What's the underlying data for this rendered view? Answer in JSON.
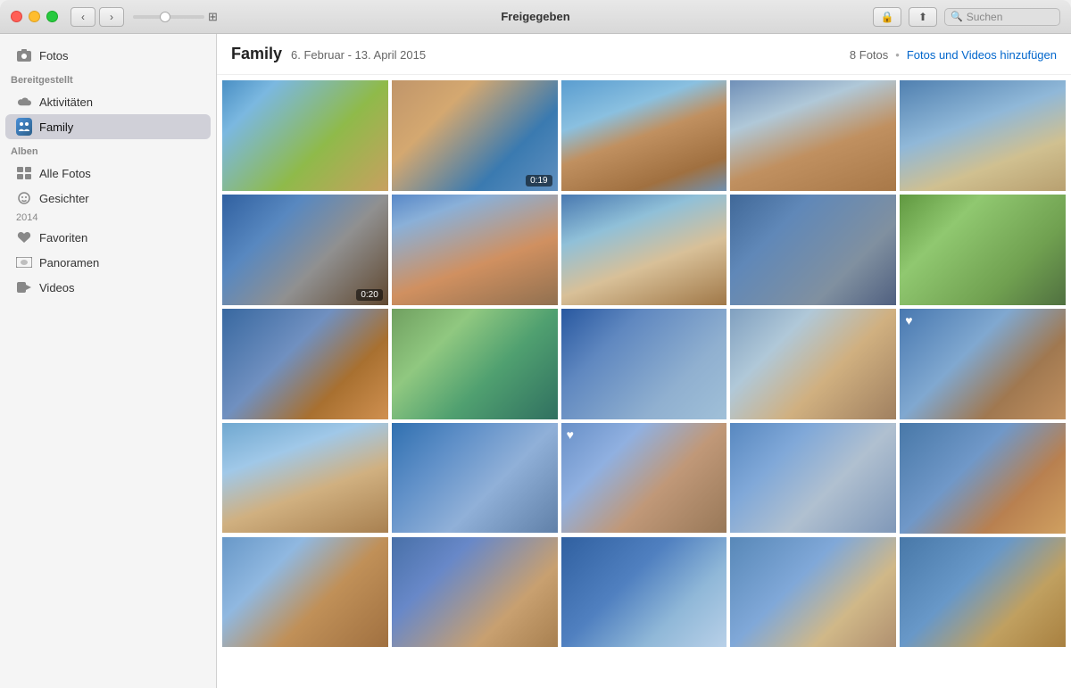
{
  "titleBar": {
    "title": "Freigegeben",
    "searchPlaceholder": "Suchen"
  },
  "sidebar": {
    "topItems": [
      {
        "id": "fotos",
        "label": "Fotos",
        "icon": "📷",
        "iconType": "camera"
      }
    ],
    "sections": [
      {
        "label": "Bereitgestellt",
        "items": [
          {
            "id": "aktivitaeten",
            "label": "Aktivitäten",
            "icon": "☁️",
            "iconType": "cloud"
          },
          {
            "id": "family",
            "label": "Family",
            "icon": "family",
            "iconType": "family",
            "active": true
          }
        ]
      },
      {
        "label": "Alben",
        "items": [
          {
            "id": "alle-fotos",
            "label": "Alle Fotos",
            "icon": "📋",
            "iconType": "list"
          },
          {
            "id": "gesichter",
            "label": "Gesichter",
            "icon": "👤",
            "iconType": "face",
            "badge": ""
          },
          {
            "id": "favoriten",
            "label": "Favoriten",
            "icon": "♥",
            "iconType": "heart"
          },
          {
            "id": "panoramen",
            "label": "Panoramen",
            "icon": "🖼",
            "iconType": "panorama"
          },
          {
            "id": "videos",
            "label": "Videos",
            "icon": "▶",
            "iconType": "video"
          }
        ]
      }
    ],
    "year2014": "2014"
  },
  "contentHeader": {
    "title": "Family",
    "dateRange": "6. Februar - 13. April 2015",
    "count": "8 Fotos",
    "separator": "•",
    "addLink": "Fotos und Videos hinzufügen"
  },
  "photos": [
    {
      "id": 1,
      "colorClass": "p1",
      "hasVideo": false,
      "isFavorite": false,
      "videoDuration": ""
    },
    {
      "id": 2,
      "colorClass": "p2",
      "hasVideo": true,
      "isFavorite": false,
      "videoDuration": "0:19"
    },
    {
      "id": 3,
      "colorClass": "p3",
      "hasVideo": false,
      "isFavorite": false,
      "videoDuration": ""
    },
    {
      "id": 4,
      "colorClass": "p4",
      "hasVideo": false,
      "isFavorite": false,
      "videoDuration": ""
    },
    {
      "id": 5,
      "colorClass": "p5",
      "hasVideo": false,
      "isFavorite": false,
      "videoDuration": ""
    },
    {
      "id": 6,
      "colorClass": "p6",
      "hasVideo": true,
      "isFavorite": false,
      "videoDuration": "0:20"
    },
    {
      "id": 7,
      "colorClass": "p7",
      "hasVideo": false,
      "isFavorite": false,
      "videoDuration": ""
    },
    {
      "id": 8,
      "colorClass": "p8",
      "hasVideo": false,
      "isFavorite": false,
      "videoDuration": ""
    },
    {
      "id": 9,
      "colorClass": "p9",
      "hasVideo": false,
      "isFavorite": false,
      "videoDuration": ""
    },
    {
      "id": 10,
      "colorClass": "p10",
      "hasVideo": false,
      "isFavorite": false,
      "videoDuration": ""
    },
    {
      "id": 11,
      "colorClass": "p11",
      "hasVideo": false,
      "isFavorite": false,
      "videoDuration": ""
    },
    {
      "id": 12,
      "colorClass": "p12",
      "hasVideo": false,
      "isFavorite": false,
      "videoDuration": ""
    },
    {
      "id": 13,
      "colorClass": "p13",
      "hasVideo": false,
      "isFavorite": false,
      "videoDuration": ""
    },
    {
      "id": 14,
      "colorClass": "p14",
      "hasVideo": false,
      "isFavorite": false,
      "videoDuration": ""
    },
    {
      "id": 15,
      "colorClass": "p15",
      "hasVideo": false,
      "isFavorite": true,
      "videoDuration": ""
    },
    {
      "id": 16,
      "colorClass": "p16",
      "hasVideo": false,
      "isFavorite": false,
      "videoDuration": ""
    },
    {
      "id": 17,
      "colorClass": "p17",
      "hasVideo": false,
      "isFavorite": false,
      "videoDuration": ""
    },
    {
      "id": 18,
      "colorClass": "p18",
      "hasVideo": false,
      "isFavorite": true,
      "videoDuration": ""
    },
    {
      "id": 19,
      "colorClass": "p19",
      "hasVideo": false,
      "isFavorite": false,
      "videoDuration": ""
    },
    {
      "id": 20,
      "colorClass": "p20",
      "hasVideo": false,
      "isFavorite": false,
      "videoDuration": ""
    },
    {
      "id": 21,
      "colorClass": "p21",
      "hasVideo": false,
      "isFavorite": false,
      "videoDuration": ""
    },
    {
      "id": 22,
      "colorClass": "p22",
      "hasVideo": false,
      "isFavorite": false,
      "videoDuration": ""
    },
    {
      "id": 23,
      "colorClass": "p23",
      "hasVideo": false,
      "isFavorite": false,
      "videoDuration": ""
    },
    {
      "id": 24,
      "colorClass": "p24",
      "hasVideo": false,
      "isFavorite": false,
      "videoDuration": ""
    },
    {
      "id": 25,
      "colorClass": "p25",
      "hasVideo": false,
      "isFavorite": false,
      "videoDuration": ""
    }
  ]
}
